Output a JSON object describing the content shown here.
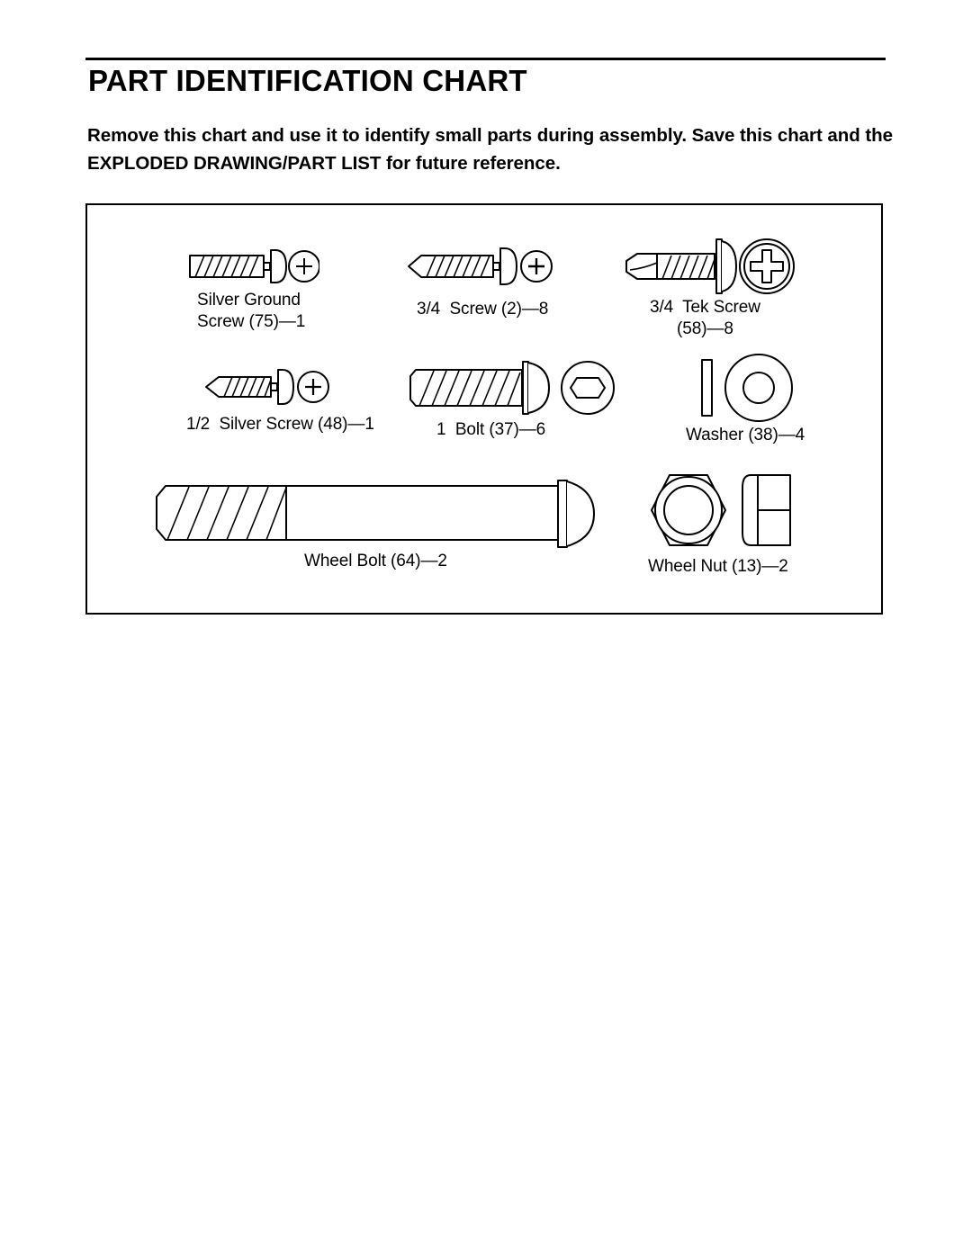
{
  "document": {
    "title": "PART IDENTIFICATION CHART",
    "intro": "Remove this chart and use it to identify small parts during assembly. Save this chart and the EXPLODED DRAWING/PART LIST for future reference."
  },
  "chart_data": {
    "type": "table",
    "title": "PART IDENTIFICATION CHART",
    "parts": [
      {
        "name": "Silver Ground Screw",
        "part_number": "75",
        "quantity": "1",
        "label": "Silver Ground\nScrew (75)—1",
        "icon": "flat-end-pan-head-screw-icon",
        "head_view": "phillips-cross-icon"
      },
      {
        "name": "3/4 Screw",
        "part_number": "2",
        "quantity": "8",
        "label": "3/4  Screw (2)—8",
        "icon": "pointed-pan-head-screw-icon",
        "head_view": "phillips-cross-icon"
      },
      {
        "name": "3/4 Tek Screw",
        "part_number": "58",
        "quantity": "8",
        "label": "3/4  Tek Screw\n(58)—8",
        "icon": "tek-self-drilling-screw-icon",
        "head_view": "phillips-cross-washer-head-icon"
      },
      {
        "name": "1/2 Silver Screw",
        "part_number": "48",
        "quantity": "1",
        "label": "1/2  Silver Screw (48)—1",
        "icon": "pointed-pan-head-screw-icon",
        "head_view": "phillips-cross-icon"
      },
      {
        "name": "1 Bolt",
        "part_number": "37",
        "quantity": "6",
        "label": "1  Bolt (37)—6",
        "icon": "dome-head-bolt-icon",
        "head_view": "hex-socket-icon"
      },
      {
        "name": "Washer",
        "part_number": "38",
        "quantity": "4",
        "label": "Washer (38)—4",
        "icon": "washer-side-view-icon",
        "head_view": "washer-annulus-icon"
      },
      {
        "name": "Wheel Bolt",
        "part_number": "64",
        "quantity": "2",
        "label": "Wheel Bolt (64)—2",
        "icon": "long-wheel-bolt-icon",
        "head_view": "dome-head-icon"
      },
      {
        "name": "Wheel Nut",
        "part_number": "13",
        "quantity": "2",
        "label": "Wheel Nut (13)—2",
        "icon": "hex-nut-face-view-icon",
        "head_view": "hex-nut-side-view-icon"
      }
    ]
  }
}
